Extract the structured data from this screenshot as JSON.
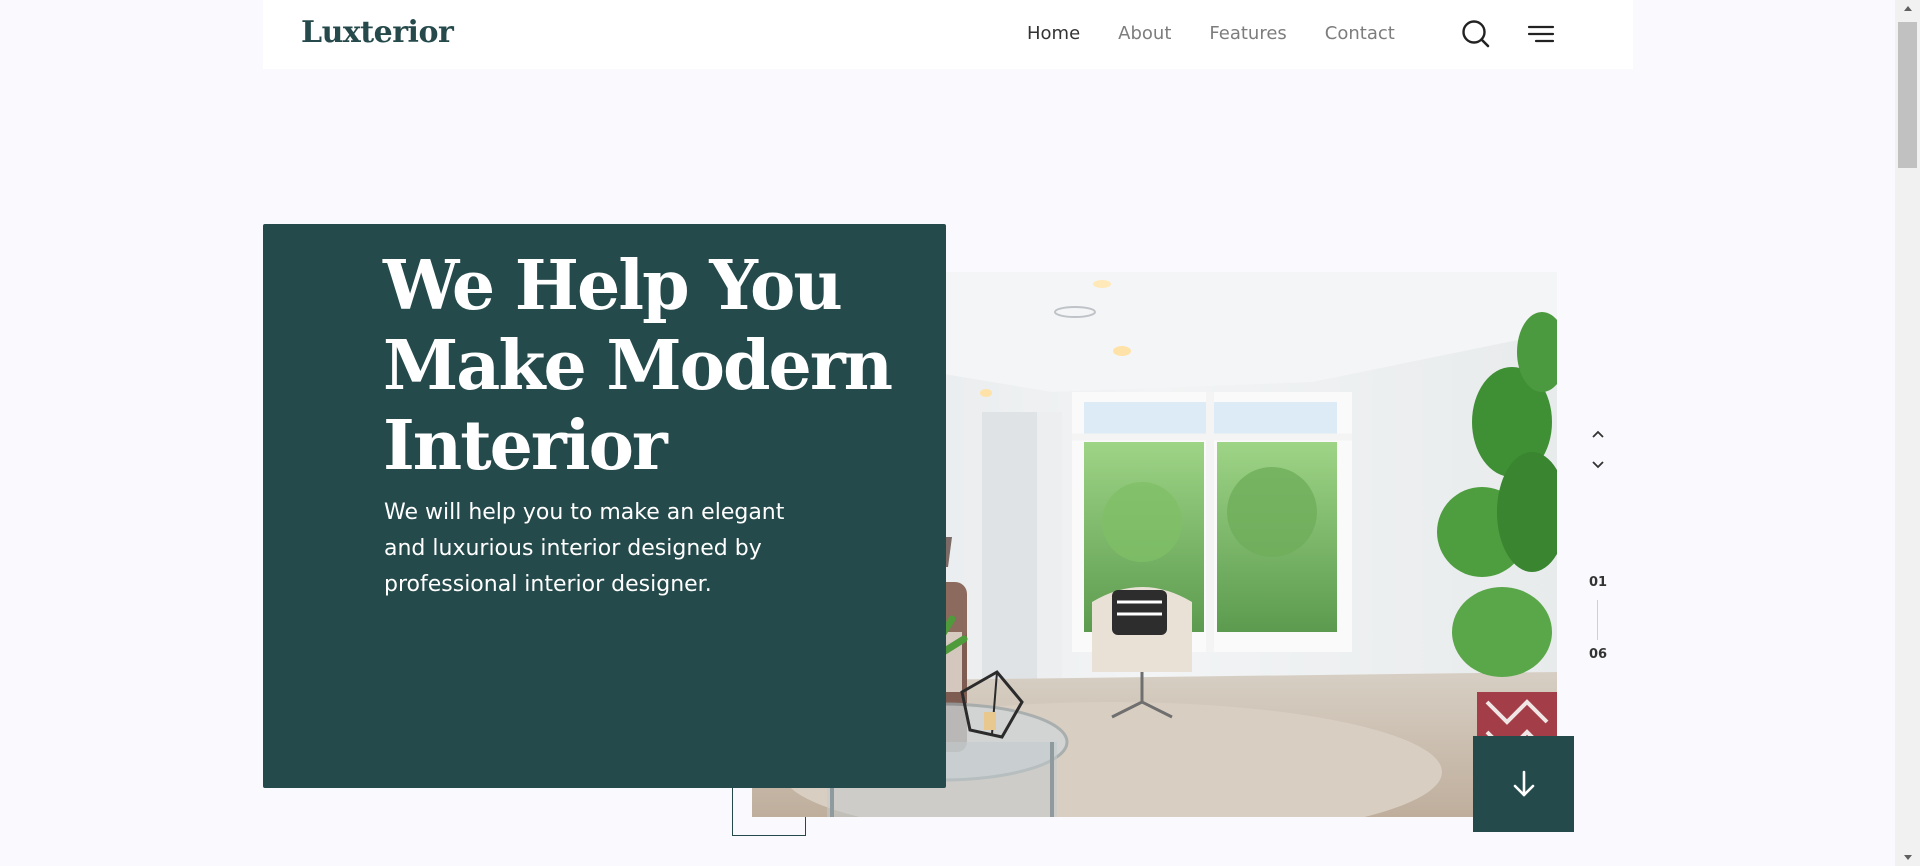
{
  "header": {
    "logo": "Luxterior",
    "nav": [
      {
        "label": "Home",
        "active": true
      },
      {
        "label": "About",
        "active": false
      },
      {
        "label": "Features",
        "active": false
      },
      {
        "label": "Contact",
        "active": false
      }
    ],
    "icons": {
      "search": "search-icon",
      "menu": "menu-icon"
    }
  },
  "hero": {
    "title_lines": [
      "We Help You",
      "Make Modern",
      "Interior"
    ],
    "subtitle": "We will help you to make an elegant and luxurious interior designed by professional interior designer.",
    "image": "living-room-photo"
  },
  "slider": {
    "current": "01",
    "total": "06",
    "icons": {
      "prev": "chevron-up-icon",
      "next": "chevron-down-icon",
      "scroll": "arrow-down-icon"
    }
  },
  "colors": {
    "brand": "#254a4b",
    "background": "#fafafe",
    "nav_active": "#333333",
    "nav_inactive": "#7d7d7d"
  }
}
